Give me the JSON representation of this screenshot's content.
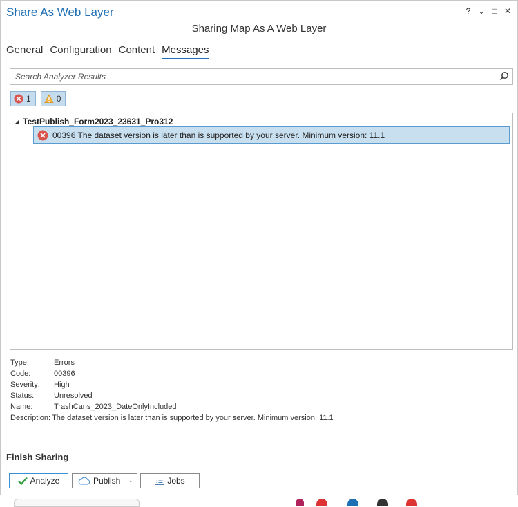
{
  "window": {
    "title": "Share As Web Layer",
    "controls": {
      "help": "?",
      "dropdown": "⌄",
      "maximize": "□",
      "close": "✕"
    }
  },
  "subtitle": "Sharing Map As A Web Layer",
  "tabs": [
    {
      "label": "General",
      "active": false
    },
    {
      "label": "Configuration",
      "active": false
    },
    {
      "label": "Content",
      "active": false
    },
    {
      "label": "Messages",
      "active": true
    }
  ],
  "search": {
    "placeholder": "Search Analyzer Results",
    "value": ""
  },
  "filters": {
    "errors_count": "1",
    "warnings_count": "0"
  },
  "tree": {
    "root_label": "TestPublish_Form2023_23631_Pro312",
    "message": "00396 The dataset version is later than is supported by your server. Minimum version: 11.1"
  },
  "details": [
    {
      "key": "Type:",
      "value": "Errors"
    },
    {
      "key": "Code:",
      "value": "00396"
    },
    {
      "key": "Severity:",
      "value": "High"
    },
    {
      "key": "Status:",
      "value": "Unresolved"
    },
    {
      "key": "Name:",
      "value": "TrashCans_2023_DateOnlyIncluded"
    },
    {
      "key": "Description:",
      "value": "The dataset version is later than is supported by your server. Minimum version: 11.1"
    }
  ],
  "finish": {
    "heading": "Finish Sharing",
    "analyze_label": "Analyze",
    "publish_label": "Publish",
    "jobs_label": "Jobs"
  },
  "colors": {
    "accent": "#1f6fb5",
    "selection": "#c8dff0",
    "error": "#d9534f",
    "warning": "#f0a030"
  }
}
